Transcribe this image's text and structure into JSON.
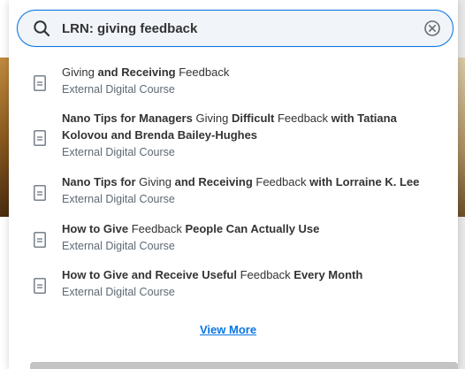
{
  "search": {
    "value": "LRN: giving feedback",
    "icon": "search-icon",
    "clear_icon": "clear-icon"
  },
  "results": [
    {
      "title_parts": [
        {
          "text": "Giving",
          "bold": false
        },
        {
          "text": " and Receiving ",
          "bold": true
        },
        {
          "text": "Feedback",
          "bold": false
        }
      ],
      "type": "External Digital Course"
    },
    {
      "title_parts": [
        {
          "text": "Nano Tips for Managers ",
          "bold": true
        },
        {
          "text": "Giving",
          "bold": false
        },
        {
          "text": " Difficult ",
          "bold": true
        },
        {
          "text": "Feedback",
          "bold": false
        },
        {
          "text": " with Tatiana Kolovou and Brenda Bailey-Hughes",
          "bold": true
        }
      ],
      "type": "External Digital Course"
    },
    {
      "title_parts": [
        {
          "text": "Nano Tips for ",
          "bold": true
        },
        {
          "text": "Giving",
          "bold": false
        },
        {
          "text": " and Receiving ",
          "bold": true
        },
        {
          "text": "Feedback",
          "bold": false
        },
        {
          "text": " with Lorraine K. Lee",
          "bold": true
        }
      ],
      "type": "External Digital Course"
    },
    {
      "title_parts": [
        {
          "text": "How to Give ",
          "bold": true
        },
        {
          "text": "Feedback",
          "bold": false
        },
        {
          "text": " People Can Actually Use",
          "bold": true
        }
      ],
      "type": "External Digital Course"
    },
    {
      "title_parts": [
        {
          "text": "How to Give and Receive Useful ",
          "bold": true
        },
        {
          "text": "Feedback",
          "bold": false
        },
        {
          "text": " Every Month",
          "bold": true
        }
      ],
      "type": "External Digital Course"
    }
  ],
  "view_more_label": "View More",
  "colors": {
    "accent": "#0875e1",
    "text": "#333333",
    "subtext": "#5e6a75"
  }
}
